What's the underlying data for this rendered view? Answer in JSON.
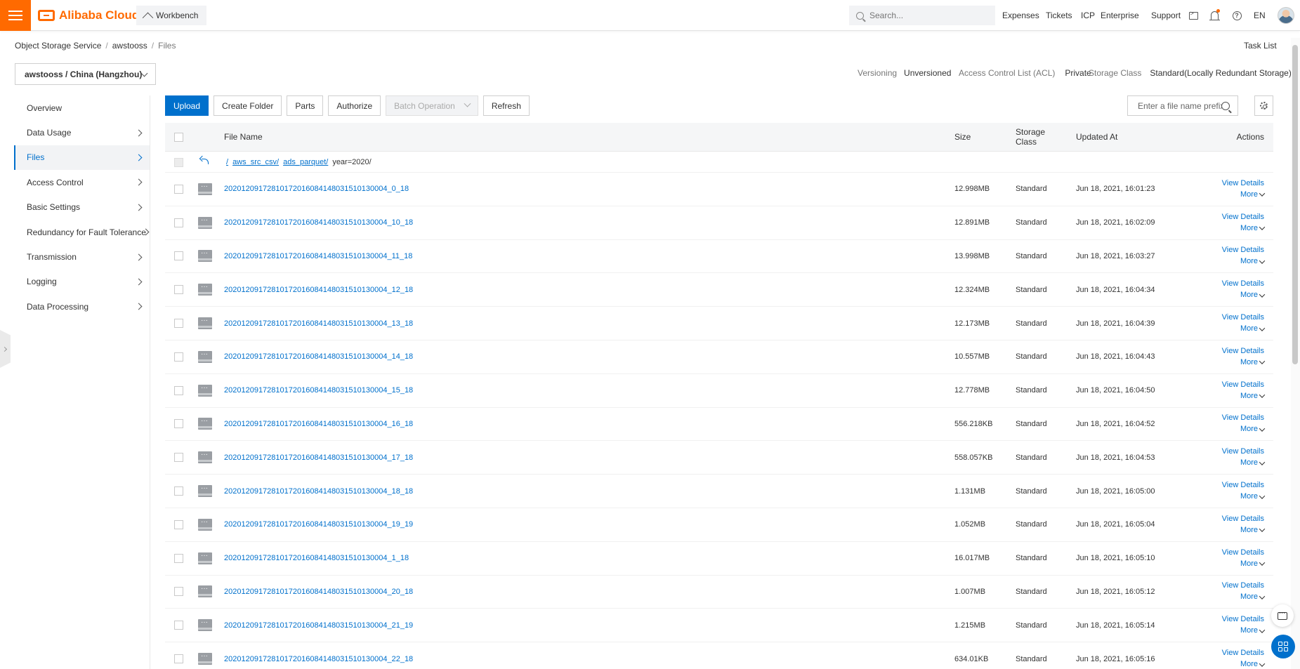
{
  "topbar": {
    "brand": "Alibaba Cloud",
    "workbench": "Workbench",
    "search_placeholder": "Search...",
    "nav": [
      "Expenses",
      "Tickets",
      "ICP",
      "Enterprise",
      "Support"
    ],
    "lang": "EN",
    "accent_color": "#ff6a00"
  },
  "breadcrumb": [
    "Object Storage Service",
    "awstooss",
    "Files"
  ],
  "task_list": "Task List",
  "bucket_select": "awstooss / China (Hangzhou)",
  "bucket_meta": {
    "versioning_label": "Versioning",
    "versioning_value": "Unversioned",
    "acl_label": "Access Control List (ACL)",
    "acl_value": "Private",
    "storage_label": "Storage Class",
    "storage_value": "Standard(Locally Redundant Storage)"
  },
  "sidebar": {
    "items": [
      {
        "label": "Overview",
        "chevron": false,
        "active": false
      },
      {
        "label": "Data Usage",
        "chevron": true,
        "active": false
      },
      {
        "label": "Files",
        "chevron": true,
        "active": true
      },
      {
        "label": "Access Control",
        "chevron": true,
        "active": false
      },
      {
        "label": "Basic Settings",
        "chevron": true,
        "active": false
      },
      {
        "label": "Redundancy for Fault Tolerance",
        "chevron": true,
        "active": false
      },
      {
        "label": "Transmission",
        "chevron": true,
        "active": false
      },
      {
        "label": "Logging",
        "chevron": true,
        "active": false
      },
      {
        "label": "Data Processing",
        "chevron": true,
        "active": false
      }
    ]
  },
  "toolbar": {
    "upload": "Upload",
    "create_folder": "Create Folder",
    "parts": "Parts",
    "authorize": "Authorize",
    "batch_operation": "Batch Operation",
    "refresh": "Refresh",
    "prefix_placeholder": "Enter a file name prefix"
  },
  "table": {
    "columns": {
      "file_name": "File Name",
      "size": "Size",
      "storage_class": "Storage Class",
      "updated_at": "Updated At",
      "actions": "Actions"
    },
    "path": {
      "root": "/",
      "segments": [
        "aws_src_csv/",
        "ads_parquet/"
      ],
      "current": "year=2020/"
    },
    "action_labels": {
      "view_details": "View Details",
      "more": "More"
    },
    "rows": [
      {
        "name": "20201209172810172016084148031510130004_0_18",
        "size": "12.998MB",
        "storage": "Standard",
        "updated": "Jun 18, 2021, 16:01:23"
      },
      {
        "name": "20201209172810172016084148031510130004_10_18",
        "size": "12.891MB",
        "storage": "Standard",
        "updated": "Jun 18, 2021, 16:02:09"
      },
      {
        "name": "20201209172810172016084148031510130004_11_18",
        "size": "13.998MB",
        "storage": "Standard",
        "updated": "Jun 18, 2021, 16:03:27"
      },
      {
        "name": "20201209172810172016084148031510130004_12_18",
        "size": "12.324MB",
        "storage": "Standard",
        "updated": "Jun 18, 2021, 16:04:34"
      },
      {
        "name": "20201209172810172016084148031510130004_13_18",
        "size": "12.173MB",
        "storage": "Standard",
        "updated": "Jun 18, 2021, 16:04:39"
      },
      {
        "name": "20201209172810172016084148031510130004_14_18",
        "size": "10.557MB",
        "storage": "Standard",
        "updated": "Jun 18, 2021, 16:04:43"
      },
      {
        "name": "20201209172810172016084148031510130004_15_18",
        "size": "12.778MB",
        "storage": "Standard",
        "updated": "Jun 18, 2021, 16:04:50"
      },
      {
        "name": "20201209172810172016084148031510130004_16_18",
        "size": "556.218KB",
        "storage": "Standard",
        "updated": "Jun 18, 2021, 16:04:52"
      },
      {
        "name": "20201209172810172016084148031510130004_17_18",
        "size": "558.057KB",
        "storage": "Standard",
        "updated": "Jun 18, 2021, 16:04:53"
      },
      {
        "name": "20201209172810172016084148031510130004_18_18",
        "size": "1.131MB",
        "storage": "Standard",
        "updated": "Jun 18, 2021, 16:05:00"
      },
      {
        "name": "20201209172810172016084148031510130004_19_19",
        "size": "1.052MB",
        "storage": "Standard",
        "updated": "Jun 18, 2021, 16:05:04"
      },
      {
        "name": "20201209172810172016084148031510130004_1_18",
        "size": "16.017MB",
        "storage": "Standard",
        "updated": "Jun 18, 2021, 16:05:10"
      },
      {
        "name": "20201209172810172016084148031510130004_20_18",
        "size": "1.007MB",
        "storage": "Standard",
        "updated": "Jun 18, 2021, 16:05:12"
      },
      {
        "name": "20201209172810172016084148031510130004_21_19",
        "size": "1.215MB",
        "storage": "Standard",
        "updated": "Jun 18, 2021, 16:05:14"
      },
      {
        "name": "20201209172810172016084148031510130004_22_18",
        "size": "634.01KB",
        "storage": "Standard",
        "updated": "Jun 18, 2021, 16:05:16"
      }
    ]
  }
}
